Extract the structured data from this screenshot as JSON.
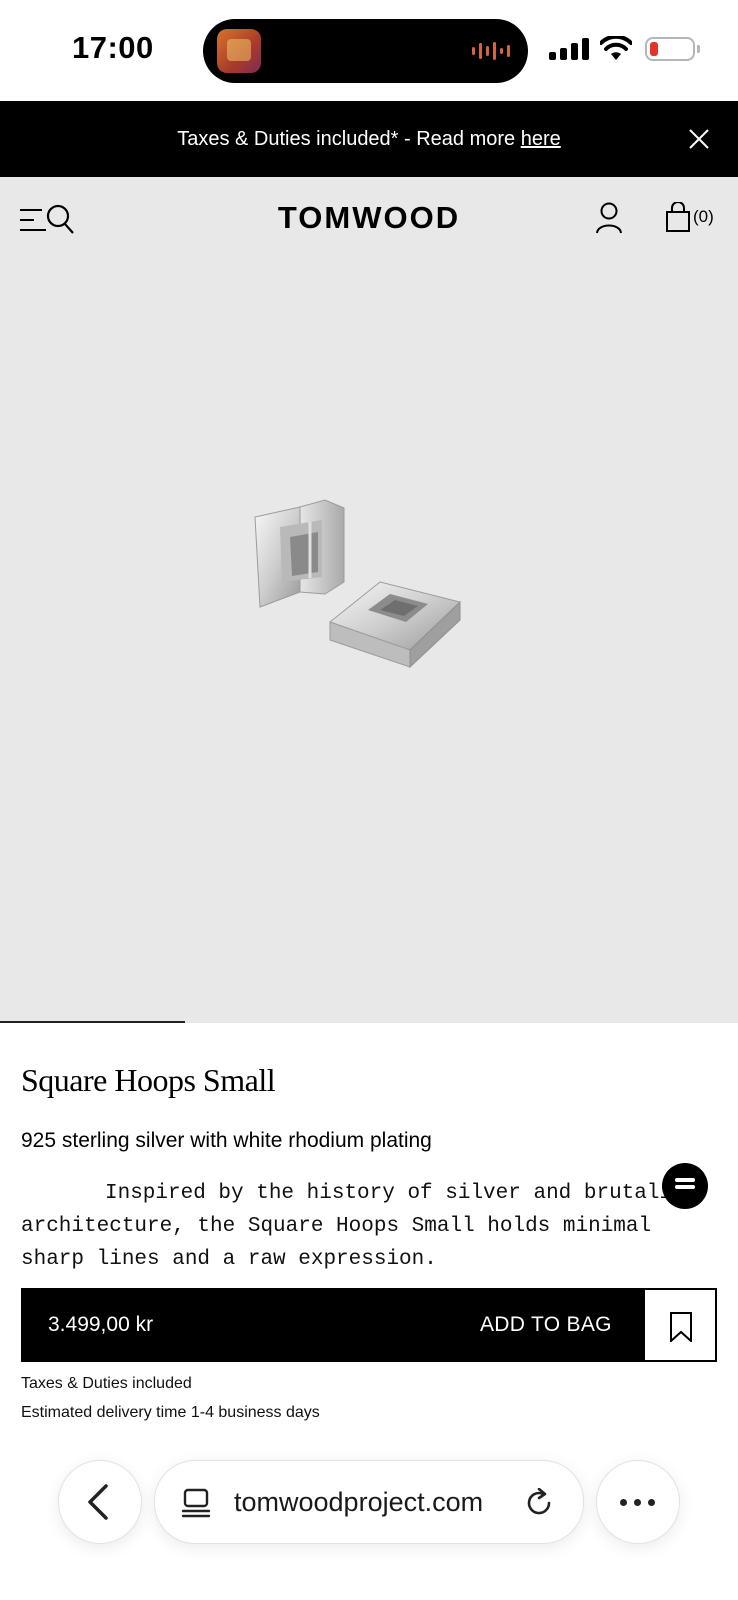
{
  "status_bar": {
    "time": "17:00"
  },
  "promo_banner": {
    "text": "Taxes & Duties included* - Read more ",
    "link_label": "here"
  },
  "header": {
    "logo": "TOMWOOD",
    "bag_count": "(0)"
  },
  "product": {
    "title": "Square Hoops Small",
    "material": "925 sterling silver with white rhodium plating",
    "description": "Inspired by the history of silver and brutalist architecture, the Square Hoops Small holds minimal sharp lines and a raw expression.",
    "price": "3.499,00 kr",
    "add_to_bag_label": "ADD TO BAG",
    "taxes_note": "Taxes & Duties included",
    "delivery_note": "Estimated delivery time 1-4 business days",
    "gallery_progress": 0.25
  },
  "browser": {
    "url": "tomwoodproject.com"
  },
  "icons": {
    "menu": "menu-icon",
    "search": "search-icon",
    "account": "account-icon",
    "bag": "bag-icon",
    "close": "close-icon",
    "chat": "chat-icon",
    "bookmark": "bookmark-icon",
    "back": "chevron-left-icon",
    "tabs": "tabs-icon",
    "reload": "reload-icon",
    "more": "more-icon"
  },
  "colors": {
    "banner_bg": "#000000",
    "hero_bg": "#e8e8e8",
    "battery_low": "#e5332a",
    "audio_wave": "#d5643b"
  }
}
